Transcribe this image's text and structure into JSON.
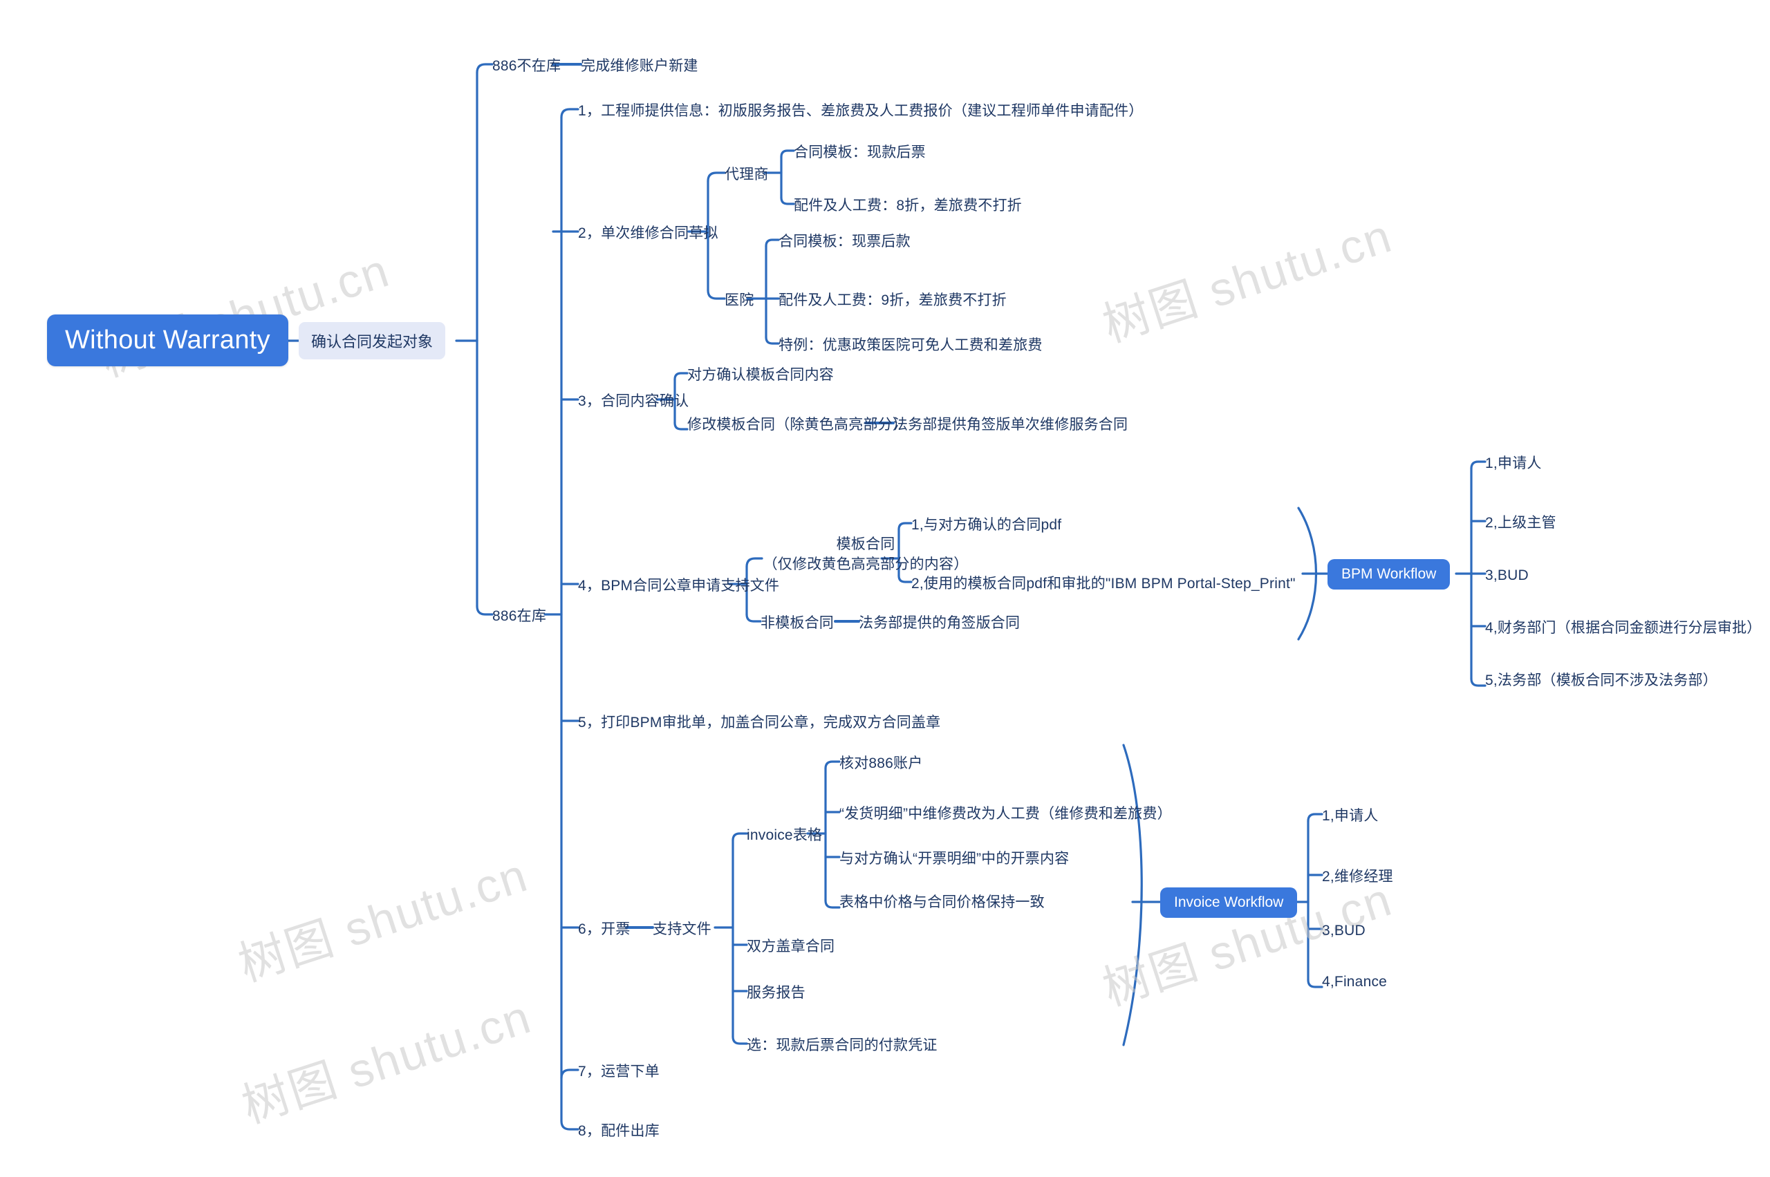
{
  "doc": {
    "type": "mindmap",
    "background": "#ffffff",
    "accent": "#3a78dd",
    "text_color": "#1f3864",
    "soft_fill": "#e4e9f7"
  },
  "watermarks": [
    "树图 shutu.cn",
    "树图 shutu.cn",
    "树图 shutu.cn",
    "树图 shutu.cn",
    "树图 shutu.cn"
  ],
  "root": {
    "label": "Without Warranty"
  },
  "level1": {
    "label": "确认合同发起对象"
  },
  "branches": {
    "not_in_stock": {
      "label": "886不在库",
      "child": "完成维修账户新建"
    },
    "in_stock": {
      "label": "886在库",
      "steps": [
        {
          "id": "s1",
          "label": "1，工程师提供信息：初版服务报告、差旅费及人工费报价（建议工程师单件申请配件）"
        },
        {
          "id": "s2",
          "label": "2，单次维修合同草拟"
        },
        {
          "id": "s3",
          "label": "3，合同内容确认"
        },
        {
          "id": "s4",
          "label": "4，BPM合同公章申请支持文件"
        },
        {
          "id": "s5",
          "label": "5，打印BPM审批单，加盖合同公章，完成双方合同盖章"
        },
        {
          "id": "s6",
          "label": "6，开票"
        },
        {
          "id": "s7",
          "label": "7，运营下单"
        },
        {
          "id": "s8",
          "label": "8，配件出库"
        }
      ]
    }
  },
  "step2": {
    "agent": {
      "label": "代理商",
      "items": [
        "合同模板：现款后票",
        "配件及人工费：8折，差旅费不打折"
      ]
    },
    "hospital": {
      "label": "医院",
      "items": [
        "合同模板：现票后款",
        "配件及人工费：9折，差旅费不打折",
        "特例：优惠政策医院可免人工费和差旅费"
      ]
    }
  },
  "step3": {
    "items": [
      {
        "label": "对方确认模板合同内容",
        "child": null
      },
      {
        "label": "修改模板合同（除黄色高亮部分）",
        "child": "法务部提供角签版单次维修服务合同"
      }
    ]
  },
  "step4": {
    "template_contract": {
      "line1": "模板合同",
      "line2": "（仅修改黄色高亮部分的内容）",
      "items": [
        "1,与对方确认的合同pdf",
        "2,使用的模板合同pdf和审批的\"IBM BPM Portal-Step_Print\""
      ]
    },
    "non_template_contract": {
      "label": "非模板合同",
      "child": "法务部提供的角签版合同"
    },
    "workflow": {
      "label": "BPM Workflow",
      "approvers": [
        "1,申请人",
        "2,上级主管",
        "3,BUD",
        "4,财务部门（根据合同金额进行分层审批）",
        "5,法务部（模板合同不涉及法务部）"
      ]
    }
  },
  "step6": {
    "support_docs": {
      "label": "支持文件",
      "items": [
        {
          "label": "invoice表格"
        },
        {
          "label": "双方盖章合同"
        },
        {
          "label": "服务报告"
        },
        {
          "label": "选：现款后票合同的付款凭证"
        }
      ]
    },
    "invoice_form_items": [
      "核对886账户",
      "“发货明细”中维修费改为人工费（维修费和差旅费）",
      "与对方确认“开票明细”中的开票内容",
      "表格中价格与合同价格保持一致"
    ],
    "workflow": {
      "label": "Invoice Workflow",
      "approvers": [
        "1,申请人",
        "2,维修经理",
        "3,BUD",
        "4,Finance"
      ]
    }
  }
}
